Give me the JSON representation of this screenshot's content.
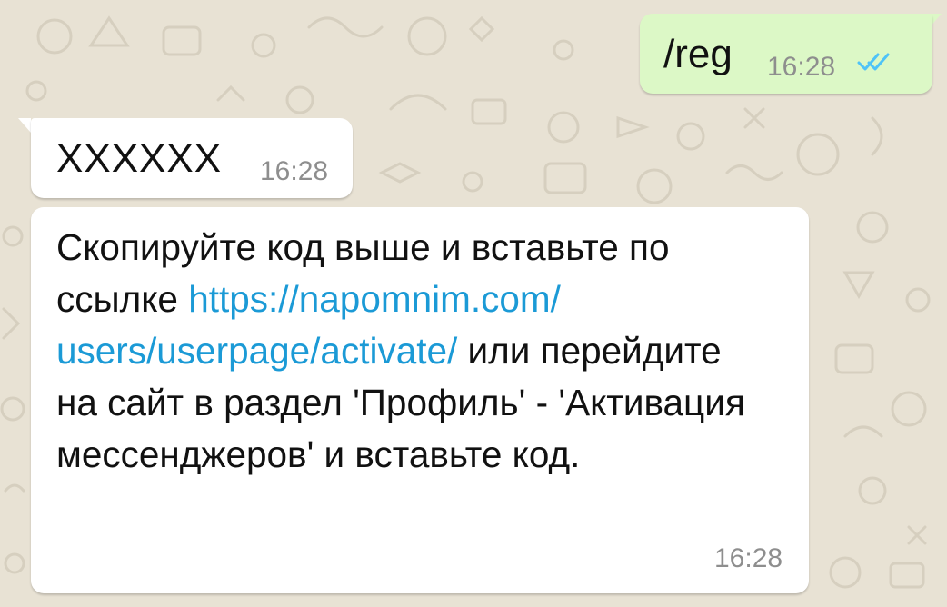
{
  "colors": {
    "wallpaper": "#e8e2d4",
    "outgoing_bubble": "#dcf8c6",
    "incoming_bubble": "#ffffff",
    "link": "#1b9ad6",
    "read_ticks": "#4fc3f7",
    "timestamp": "#8e8e8e"
  },
  "messages": [
    {
      "direction": "outgoing",
      "text": "/reg",
      "time": "16:28",
      "status_icon": "double-check-read-icon"
    },
    {
      "direction": "incoming",
      "text": "XXXXXX",
      "time": "16:28"
    },
    {
      "direction": "incoming",
      "text_before_link": "Скопируйте код выше и вставьте по ссылке ",
      "link": "https://napomnim.com/users/userpage/activate/",
      "link_line1": "https://napomnim.com/",
      "link_line2": "users/userpage/activate/",
      "text_after_link": " или перейдите на сайт в раздел 'Профиль' - 'Активация мессенджеров' и вставьте код.",
      "time": "16:28"
    }
  ]
}
